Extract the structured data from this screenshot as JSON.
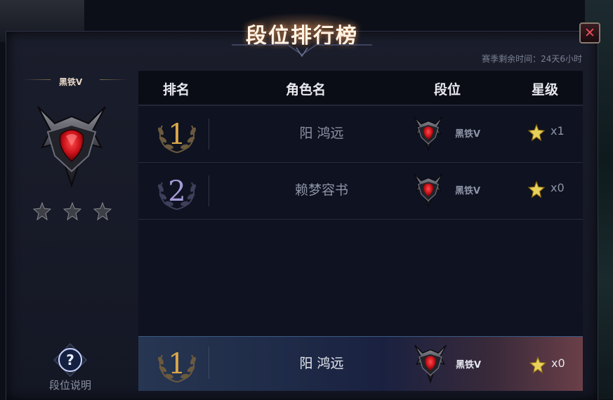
{
  "title": "段位排行榜",
  "season_remaining": "赛季剩余时间：24天6小时",
  "close_icon": "close-icon",
  "player_rank": {
    "tier_name": "黑铁V",
    "stars_total": 3
  },
  "help": {
    "label": "段位说明",
    "icon": "question-icon"
  },
  "table": {
    "headers": {
      "rank": "排名",
      "name": "角色名",
      "tier": "段位",
      "stars": "星级"
    },
    "rows": [
      {
        "rank": "1",
        "name": "阳 鸿远",
        "tier": "黑铁V",
        "stars": "x1"
      },
      {
        "rank": "2",
        "name": "赖梦容书",
        "tier": "黑铁V",
        "stars": "x0"
      }
    ]
  },
  "my_row": {
    "rank": "1",
    "name": "阳 鸿远",
    "tier": "黑铁V",
    "stars": "x0"
  },
  "colors": {
    "gold_rank": "#d9a64a",
    "silver_rank": "#a59bd8",
    "accent_red": "#e0242a"
  }
}
